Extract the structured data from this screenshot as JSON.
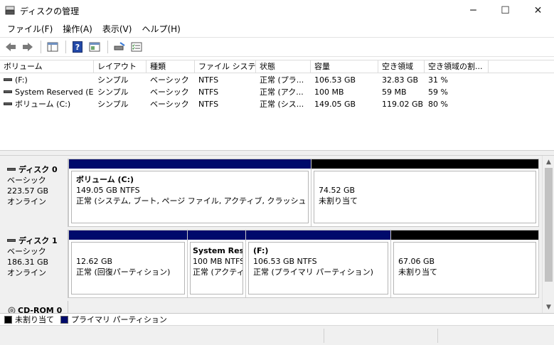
{
  "window": {
    "title": "ディスクの管理",
    "minimize": "─",
    "maximize": "☐",
    "close": "✕"
  },
  "menu": [
    "ファイル(F)",
    "操作(A)",
    "表示(V)",
    "ヘルプ(H)"
  ],
  "volume_table": {
    "columns": [
      "ボリューム",
      "レイアウト",
      "種類",
      "ファイル システム",
      "状態",
      "容量",
      "空き領域",
      "空き領域の割..."
    ],
    "rows": [
      [
        "(F:)",
        "シンプル",
        "ベーシック",
        "NTFS",
        "正常 (プラ...",
        "106.53 GB",
        "32.83 GB",
        "31 %"
      ],
      [
        "System Reserved (E:)",
        "シンプル",
        "ベーシック",
        "NTFS",
        "正常 (アク...",
        "100 MB",
        "59 MB",
        "59 %"
      ],
      [
        "ボリューム (C:)",
        "シンプル",
        "ベーシック",
        "NTFS",
        "正常 (シス...",
        "149.05 GB",
        "119.02 GB",
        "80 %"
      ]
    ]
  },
  "disks": [
    {
      "name": "ディスク 0",
      "type": "ベーシック",
      "size": "223.57 GB",
      "status": "オンライン",
      "partitions": [
        {
          "name": "ボリューム (C:)",
          "size": "149.05 GB NTFS",
          "status": "正常 (システム, ブート, ページ ファイル, アクティブ, クラッシュ ダンプ, プライ",
          "kind": "primary"
        },
        {
          "name": "",
          "size": "74.52 GB",
          "status": "未割り当て",
          "kind": "unallocated"
        }
      ]
    },
    {
      "name": "ディスク 1",
      "type": "ベーシック",
      "size": "186.31 GB",
      "status": "オンライン",
      "partitions": [
        {
          "name": "",
          "size": "12.62 GB",
          "status": "正常 (回復パーティション)",
          "kind": "primary"
        },
        {
          "name": "System Rese",
          "size": "100 MB NTFS",
          "status": "正常 (アクティ",
          "kind": "primary"
        },
        {
          "name": "(F:)",
          "size": "106.53 GB NTFS",
          "status": "正常 (プライマリ パーティション)",
          "kind": "primary"
        },
        {
          "name": "",
          "size": "67.06 GB",
          "status": "未割り当て",
          "kind": "unallocated"
        }
      ]
    },
    {
      "name": "CD-ROM 0"
    }
  ],
  "legend": [
    {
      "label": "未割り当て",
      "color": "#000000"
    },
    {
      "label": "プライマリ パーティション",
      "color": "#000a6b"
    }
  ],
  "colors": {
    "primary": "#000a6b",
    "unallocated": "#000000"
  }
}
